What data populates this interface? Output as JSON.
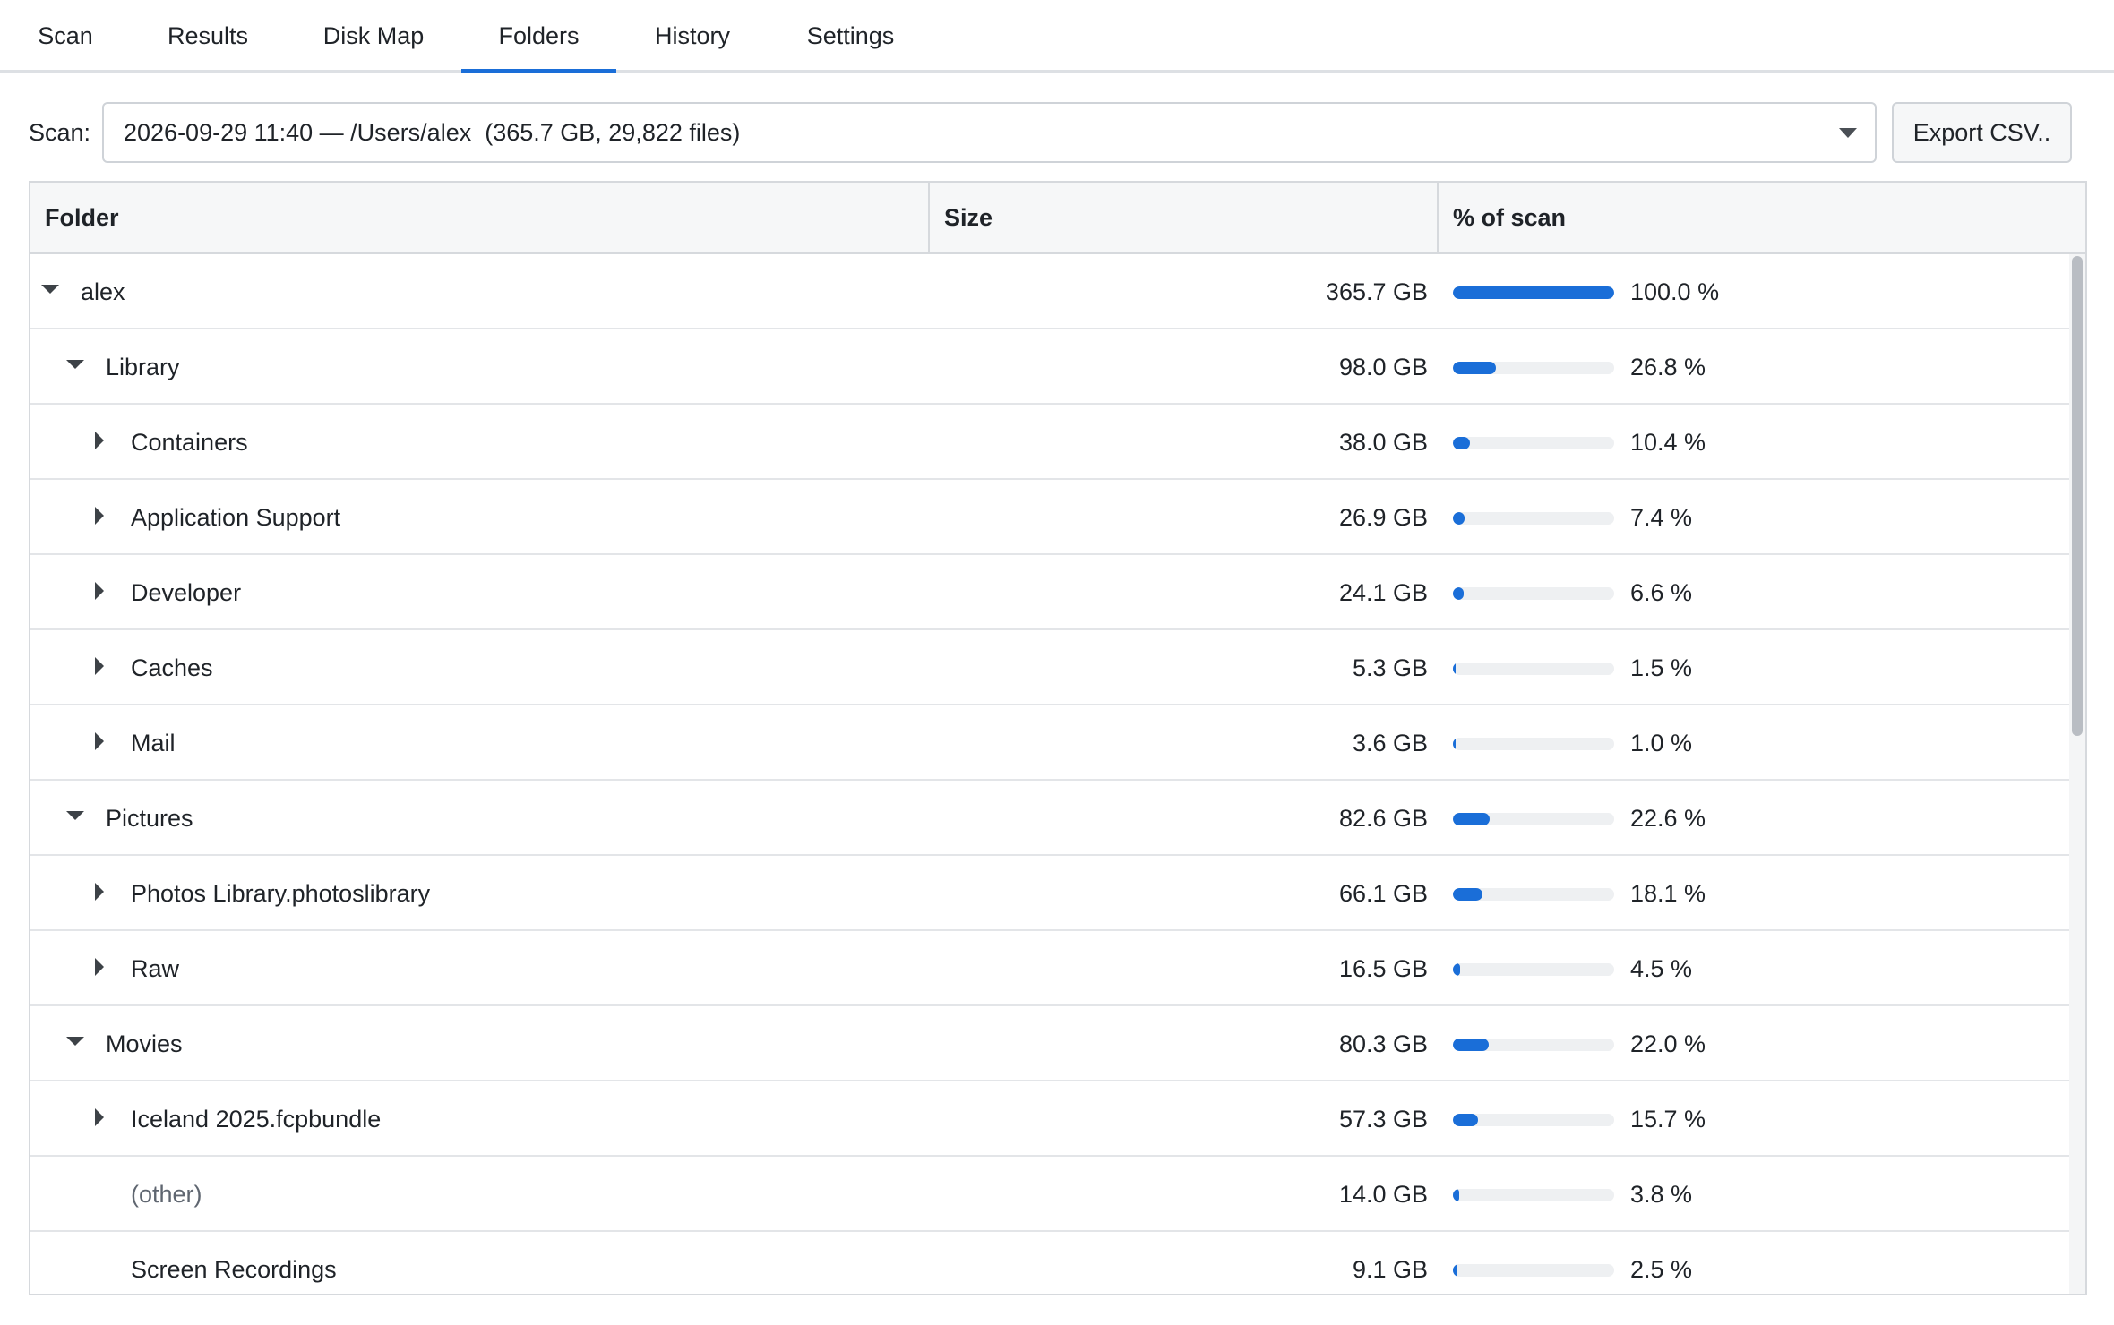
{
  "tabs": [
    {
      "label": "Scan",
      "active": false
    },
    {
      "label": "Results",
      "active": false
    },
    {
      "label": "Disk Map",
      "active": false
    },
    {
      "label": "Folders",
      "active": true
    },
    {
      "label": "History",
      "active": false
    },
    {
      "label": "Settings",
      "active": false
    }
  ],
  "toolbar": {
    "scan_label": "Scan:",
    "scan_selected": "2026-09-29 11:40 — /Users/alex  (365.7 GB, 29,822 files)",
    "export_label": "Export CSV.."
  },
  "table": {
    "columns": {
      "folder": "Folder",
      "size": "Size",
      "percent": "% of scan"
    },
    "rows": [
      {
        "name": "alex",
        "size": "365.7 GB",
        "percent_label": "100.0 %",
        "percent": 100.0,
        "level": 0,
        "toggle": "expanded",
        "muted": false
      },
      {
        "name": "Library",
        "size": "98.0 GB",
        "percent_label": "26.8 %",
        "percent": 26.8,
        "level": 1,
        "toggle": "expanded",
        "muted": false
      },
      {
        "name": "Containers",
        "size": "38.0 GB",
        "percent_label": "10.4 %",
        "percent": 10.4,
        "level": 2,
        "toggle": "collapsed",
        "muted": false
      },
      {
        "name": "Application Support",
        "size": "26.9 GB",
        "percent_label": "7.4 %",
        "percent": 7.4,
        "level": 2,
        "toggle": "collapsed",
        "muted": false
      },
      {
        "name": "Developer",
        "size": "24.1 GB",
        "percent_label": "6.6 %",
        "percent": 6.6,
        "level": 2,
        "toggle": "collapsed",
        "muted": false
      },
      {
        "name": "Caches",
        "size": "5.3 GB",
        "percent_label": "1.5 %",
        "percent": 1.5,
        "level": 2,
        "toggle": "collapsed",
        "muted": false
      },
      {
        "name": "Mail",
        "size": "3.6 GB",
        "percent_label": "1.0 %",
        "percent": 1.0,
        "level": 2,
        "toggle": "collapsed",
        "muted": false
      },
      {
        "name": "Pictures",
        "size": "82.6 GB",
        "percent_label": "22.6 %",
        "percent": 22.6,
        "level": 1,
        "toggle": "expanded",
        "muted": false
      },
      {
        "name": "Photos Library.photoslibrary",
        "size": "66.1 GB",
        "percent_label": "18.1 %",
        "percent": 18.1,
        "level": 2,
        "toggle": "collapsed",
        "muted": false
      },
      {
        "name": "Raw",
        "size": "16.5 GB",
        "percent_label": "4.5 %",
        "percent": 4.5,
        "level": 2,
        "toggle": "collapsed",
        "muted": false
      },
      {
        "name": "Movies",
        "size": "80.3 GB",
        "percent_label": "22.0 %",
        "percent": 22.0,
        "level": 1,
        "toggle": "expanded",
        "muted": false
      },
      {
        "name": "Iceland 2025.fcpbundle",
        "size": "57.3 GB",
        "percent_label": "15.7 %",
        "percent": 15.7,
        "level": 2,
        "toggle": "collapsed",
        "muted": false
      },
      {
        "name": "(other)",
        "size": "14.0 GB",
        "percent_label": "3.8 %",
        "percent": 3.8,
        "level": 2,
        "toggle": "none",
        "muted": true
      },
      {
        "name": "Screen Recordings",
        "size": "9.1 GB",
        "percent_label": "2.5 %",
        "percent": 2.5,
        "level": 2,
        "toggle": "none",
        "muted": false
      }
    ]
  },
  "colors": {
    "accent": "#1a6ed8",
    "track": "#eef0f2"
  }
}
